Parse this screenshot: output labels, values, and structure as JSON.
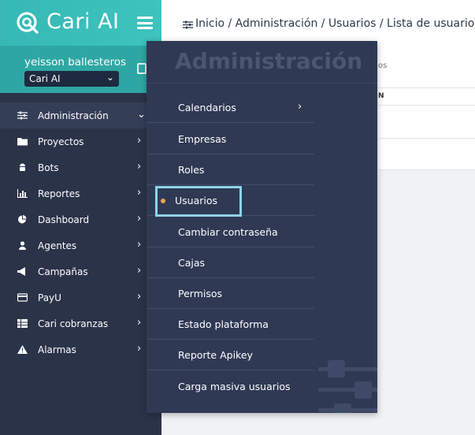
{
  "brand": {
    "name": "Cari AI"
  },
  "user": {
    "name": "yeisson ballesteros",
    "company": "Cari AI"
  },
  "nav": [
    {
      "label": "Administración",
      "icon": "sliders-icon",
      "active": true
    },
    {
      "label": "Proyectos",
      "icon": "folder-icon"
    },
    {
      "label": "Bots",
      "icon": "android-icon"
    },
    {
      "label": "Reportes",
      "icon": "bar-chart-icon"
    },
    {
      "label": "Dashboard",
      "icon": "pie-chart-icon"
    },
    {
      "label": "Agentes",
      "icon": "user-icon"
    },
    {
      "label": "Campañas",
      "icon": "megaphone-icon"
    },
    {
      "label": "PayU",
      "icon": "credit-card-icon"
    },
    {
      "label": "Cari cobranzas",
      "icon": "table-icon"
    },
    {
      "label": "Alarmas",
      "icon": "warning-icon"
    }
  ],
  "breadcrumb": "Inicio / Administración / Usuarios / Lista de usuarios",
  "flyout": {
    "title": "Administración",
    "items": [
      {
        "label": "Calendarios",
        "has_submenu": true
      },
      {
        "label": "Empresas"
      },
      {
        "label": "Roles"
      },
      {
        "label": "Usuarios",
        "current": true
      },
      {
        "label": "Cambiar contraseña"
      },
      {
        "label": "Cajas"
      },
      {
        "label": "Permisos"
      },
      {
        "label": "Estado plataforma"
      },
      {
        "label": "Reporte Apikey"
      },
      {
        "label": "Carga masiva usuarios"
      }
    ]
  },
  "content": {
    "partial_1": "os",
    "partial_2": "N"
  },
  "colors": {
    "accent": "#36b9b6",
    "sidebar": "#2b3349",
    "flyout": "#2f3954",
    "highlight": "#8dd4e8",
    "dot": "#e8a94a"
  }
}
